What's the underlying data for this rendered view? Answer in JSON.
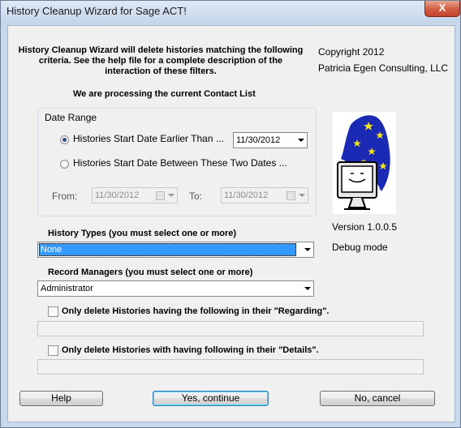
{
  "window": {
    "title": "History Cleanup Wizard for Sage ACT!",
    "close_glyph": "X"
  },
  "intro": "History Cleanup Wizard will delete histories matching the following criteria.  See the help file for a complete description of the interaction of these filters.",
  "copyright": {
    "line1": "Copyright 2012",
    "line2": "Patricia Egen Consulting, LLC"
  },
  "processing": "We are processing the current Contact List",
  "date_range": {
    "title": "Date Range",
    "option1": {
      "label": "Histories Start Date Earlier Than ...",
      "selected": true
    },
    "option1_date": "11/30/2012",
    "option2": {
      "label": "Histories Start Date Between These Two Dates ...",
      "selected": false
    },
    "from_label": "From:",
    "from_date": "11/30/2012",
    "to_label": "To:",
    "to_date": "11/30/2012"
  },
  "logo": {
    "icon": "wizard-hat-computer-logo"
  },
  "version": "Version 1.0.0.5",
  "debug": "Debug mode",
  "history_types": {
    "label": "History Types (you must select one or more)",
    "value": "None"
  },
  "record_managers": {
    "label": "Record Managers (you must select one or more)",
    "value": "Administrator"
  },
  "regarding": {
    "label": "Only delete Histories having the following in their \"Regarding\".",
    "checked": false,
    "value": ""
  },
  "details": {
    "label": "Only delete Histories with having following in their \"Details\".",
    "checked": false,
    "value": ""
  },
  "buttons": {
    "help": "Help",
    "continue": "Yes, continue",
    "cancel": "No, cancel"
  },
  "colors": {
    "selection": "#3399ff",
    "default_button_border": "#3c7fb1",
    "hat_blue": "#1b2ab5",
    "star_yellow": "#f5e61c"
  }
}
